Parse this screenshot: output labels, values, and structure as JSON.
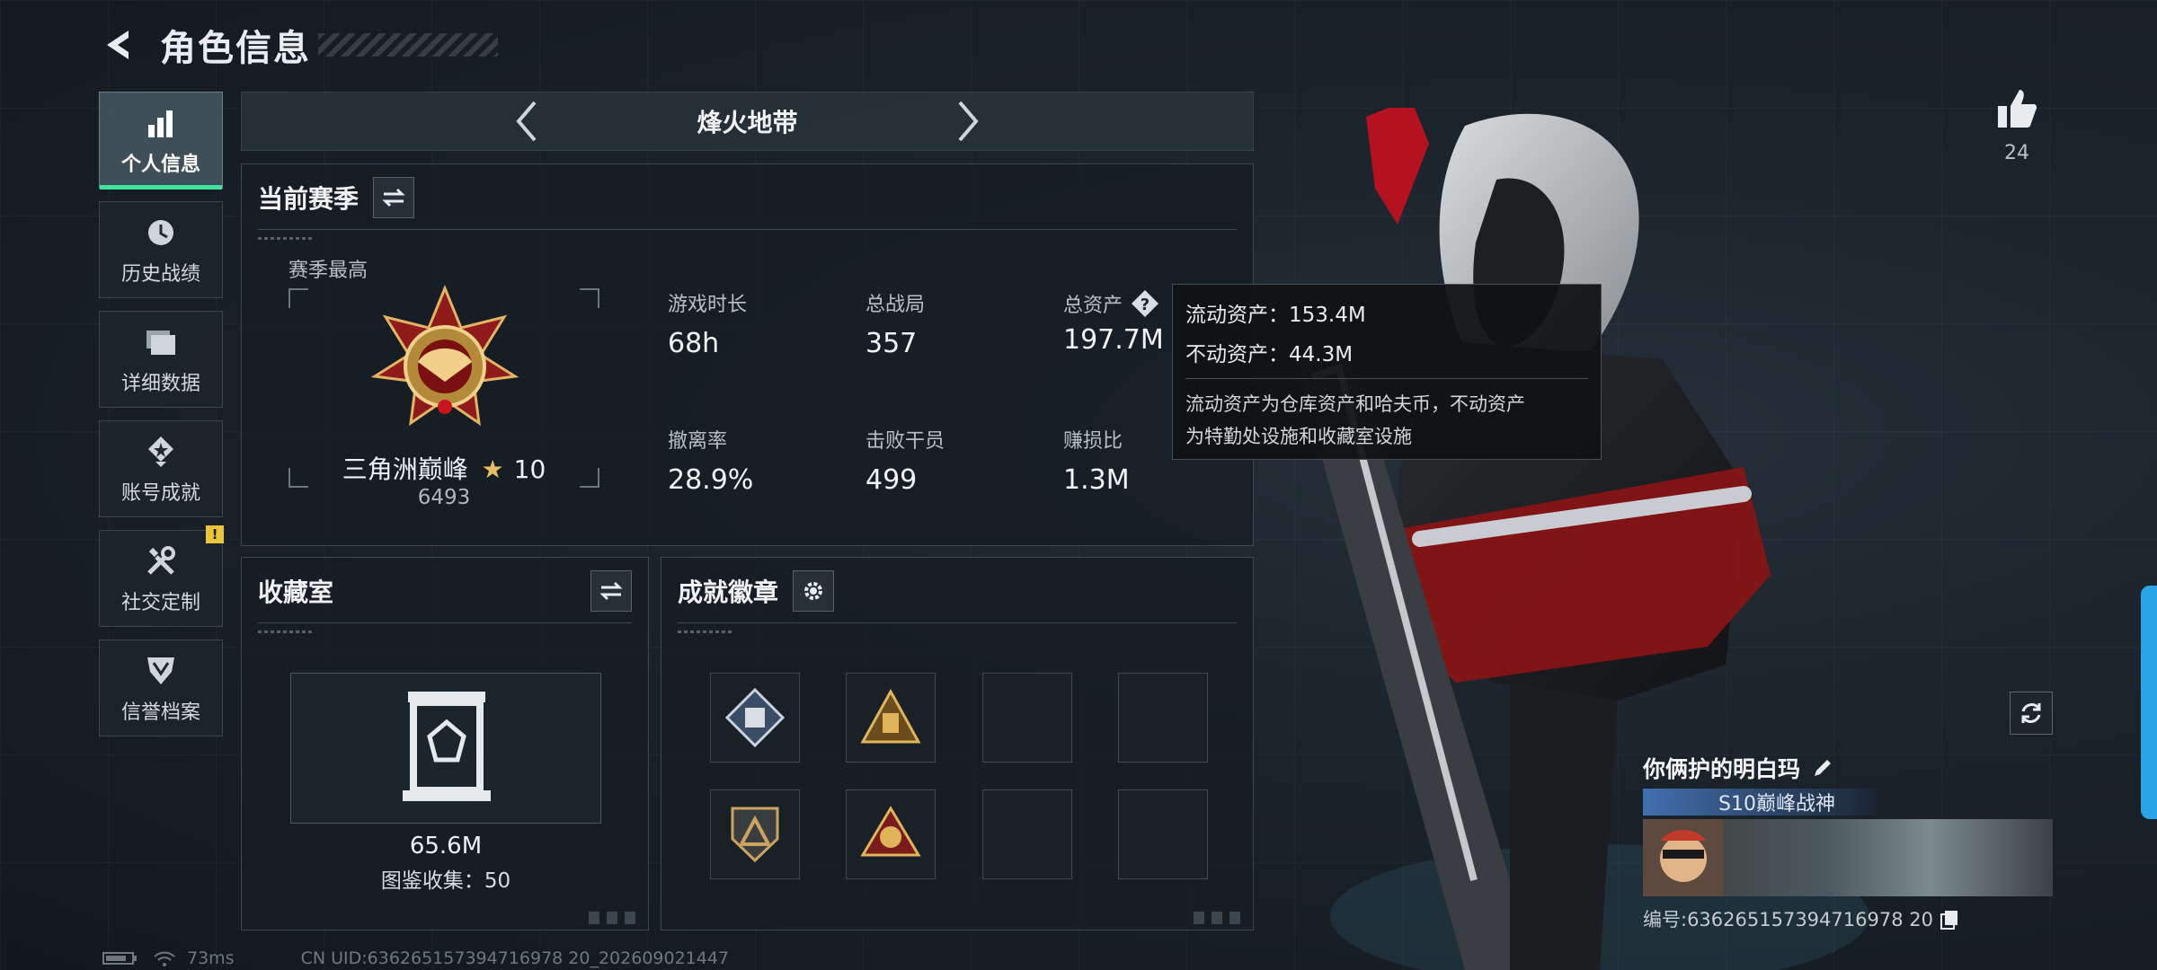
{
  "header": {
    "title": "角色信息"
  },
  "sidebar": {
    "items": [
      {
        "label": "个人信息",
        "icon": "bar-chart-icon",
        "active": true
      },
      {
        "label": "历史战绩",
        "icon": "clock-icon"
      },
      {
        "label": "详细数据",
        "icon": "folder-icon"
      },
      {
        "label": "账号成就",
        "icon": "achievement-icon"
      },
      {
        "label": "社交定制",
        "icon": "tools-icon",
        "badge": "!"
      },
      {
        "label": "信誉档案",
        "icon": "shield-icon"
      }
    ]
  },
  "mode": {
    "title": "烽火地带"
  },
  "season": {
    "title": "当前赛季",
    "best_label": "赛季最高",
    "rank_name": "三角洲巅峰",
    "rank_stars": "10",
    "rank_score": "6493",
    "stats": [
      {
        "label": "游戏时长",
        "value": "68h"
      },
      {
        "label": "总战局",
        "value": "357"
      },
      {
        "label": "总资产",
        "value": "197.7M"
      },
      {
        "label": "撤离率",
        "value": "28.9%"
      },
      {
        "label": "击败干员",
        "value": "499"
      },
      {
        "label": "赚损比",
        "value": "1.3M"
      }
    ]
  },
  "tooltip": {
    "liquid": "流动资产：153.4M",
    "fixed": "不动资产：44.3M",
    "desc_line1": "流动资产为仓库资产和哈夫币，不动资产",
    "desc_line2": "为特勤处设施和收藏室设施"
  },
  "collection": {
    "title": "收藏室",
    "value": "65.6M",
    "count": "图鉴收集：50"
  },
  "badges": {
    "title": "成就徽章"
  },
  "social": {
    "likes": "24"
  },
  "player": {
    "name": "你俩护的明白玛",
    "title": "S10巅峰战神",
    "id": "编号:636265157394716978 20"
  },
  "status": {
    "ping": "73ms",
    "uid": "CN UID:636265157394716978 20_202609021447"
  },
  "colors": {
    "accent": "#3fe39a",
    "warning": "#e9c53a",
    "edge": "#2aa4e8"
  }
}
